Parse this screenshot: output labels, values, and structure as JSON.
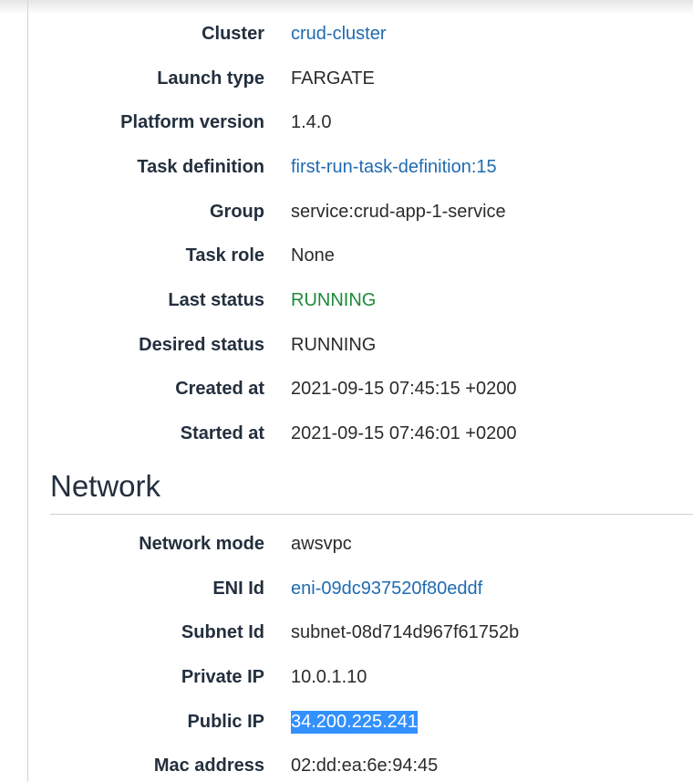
{
  "details": [
    {
      "label": "Cluster",
      "value": "crud-cluster"
    },
    {
      "label": "Launch type",
      "value": "FARGATE"
    },
    {
      "label": "Platform version",
      "value": "1.4.0"
    },
    {
      "label": "Task definition",
      "value": "first-run-task-definition:15"
    },
    {
      "label": "Group",
      "value": "service:crud-app-1-service"
    },
    {
      "label": "Task role",
      "value": "None"
    },
    {
      "label": "Last status",
      "value": "RUNNING"
    },
    {
      "label": "Desired status",
      "value": "RUNNING"
    },
    {
      "label": "Created at",
      "value": "2021-09-15 07:45:15 +0200"
    },
    {
      "label": "Started at",
      "value": "2021-09-15 07:46:01 +0200"
    }
  ],
  "network": {
    "title": "Network",
    "rows": [
      {
        "label": "Network mode",
        "value": "awsvpc"
      },
      {
        "label": "ENI Id",
        "value": "eni-09dc937520f80eddf"
      },
      {
        "label": "Subnet Id",
        "value": "subnet-08d714d967f61752b"
      },
      {
        "label": "Private IP",
        "value": "10.0.1.10"
      },
      {
        "label": "Public IP",
        "value": "34.200.225.241"
      },
      {
        "label": "Mac address",
        "value": "02:dd:ea:6e:94:45"
      }
    ]
  },
  "colors": {
    "link": "#1f6bb0",
    "running": "#1d8a3a",
    "selection": "#3390ff"
  }
}
